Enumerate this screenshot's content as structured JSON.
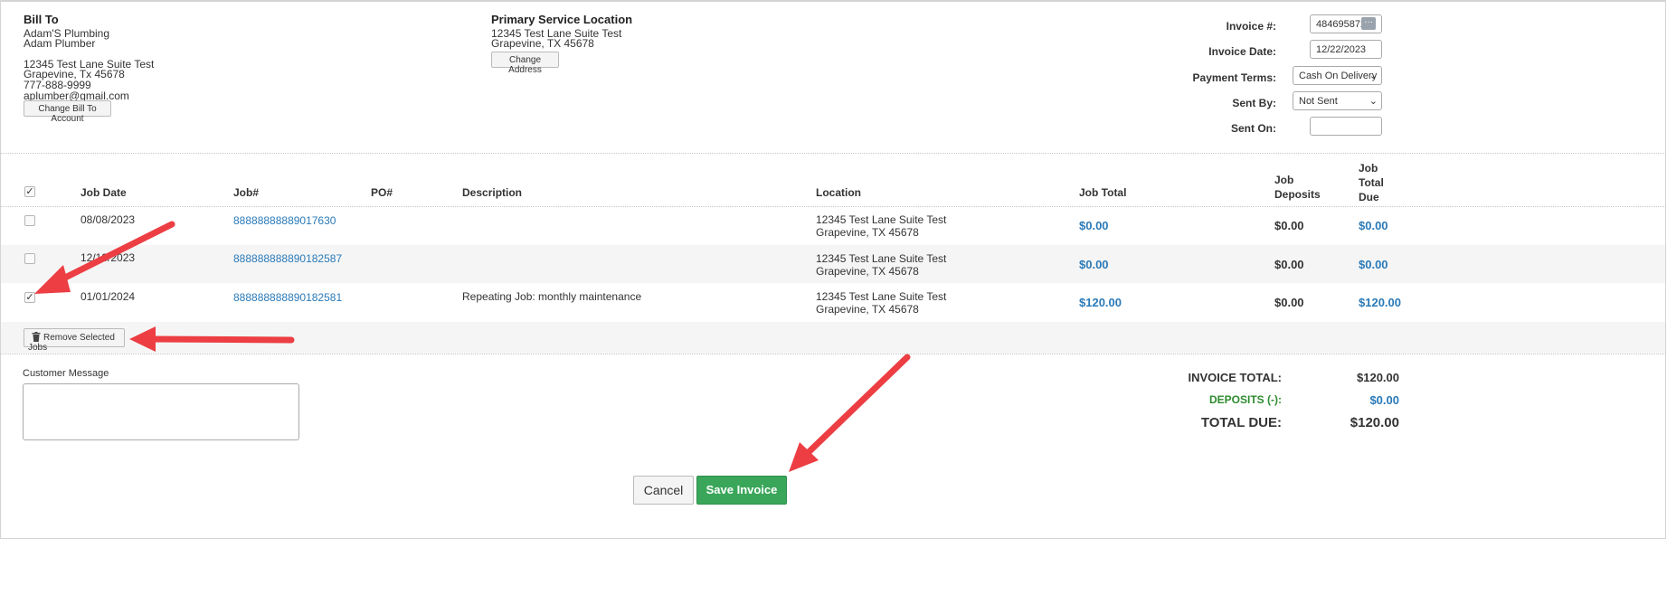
{
  "bill_to": {
    "heading": "Bill To",
    "company": "Adam'S Plumbing",
    "contact": "Adam Plumber",
    "address1": "12345 Test Lane Suite Test",
    "address2": "Grapevine, Tx 45678",
    "phone": "777-888-9999",
    "email": "aplumber@gmail.com",
    "change_button": "Change Bill To Account"
  },
  "service_location": {
    "heading": "Primary Service Location",
    "address1": "12345 Test Lane Suite Test",
    "address2": "Grapevine, TX 45678",
    "change_button": "Change Address"
  },
  "invoice_meta": {
    "invoice_number_label": "Invoice #:",
    "invoice_number_value": "4846958725",
    "invoice_date_label": "Invoice Date:",
    "invoice_date_value": "12/22/2023",
    "payment_terms_label": "Payment Terms:",
    "payment_terms_value": "Cash On Delivery",
    "sent_by_label": "Sent By:",
    "sent_by_value": "Not Sent",
    "sent_on_label": "Sent On:",
    "sent_on_value": ""
  },
  "table": {
    "headers": {
      "job_date": "Job Date",
      "job_no": "Job#",
      "po_no": "PO#",
      "description": "Description",
      "location": "Location",
      "job_total": "Job Total",
      "job_deposits": [
        "Job",
        "Deposits"
      ],
      "job_total_due": [
        "Job",
        "Total",
        "Due"
      ]
    },
    "rows": [
      {
        "checked": false,
        "date": "08/08/2023",
        "job": "88888888889017630",
        "po": "",
        "description": "",
        "loc1": "12345 Test Lane Suite Test",
        "loc2": "Grapevine, TX 45678",
        "total": "$0.00",
        "deposits": "$0.00",
        "due": "$0.00"
      },
      {
        "checked": false,
        "date": "12/13/2023",
        "job": "888888888890182587",
        "po": "",
        "description": "",
        "loc1": "12345 Test Lane Suite Test",
        "loc2": "Grapevine, TX 45678",
        "total": "$0.00",
        "deposits": "$0.00",
        "due": "$0.00"
      },
      {
        "checked": true,
        "date": "01/01/2024",
        "job": "888888888890182581",
        "po": "",
        "description": "Repeating Job: monthly maintenance",
        "loc1": "12345 Test Lane Suite Test",
        "loc2": "Grapevine, TX 45678",
        "total": "$120.00",
        "deposits": "$0.00",
        "due": "$120.00"
      }
    ],
    "remove_button": "Remove Selected Jobs"
  },
  "customer_message": {
    "label": "Customer Message",
    "value": ""
  },
  "totals": {
    "invoice_total_label": "INVOICE TOTAL:",
    "invoice_total_value": "$120.00",
    "deposits_label": "DEPOSITS (-):",
    "deposits_value": "$0.00",
    "total_due_label": "TOTAL DUE:",
    "total_due_value": "$120.00"
  },
  "actions": {
    "cancel": "Cancel",
    "save": "Save Invoice"
  },
  "colors": {
    "link": "#2a7ab8",
    "save_button": "#3aa65a",
    "deposits_green": "#2e8b2e",
    "arrow": "#ec3e43"
  }
}
